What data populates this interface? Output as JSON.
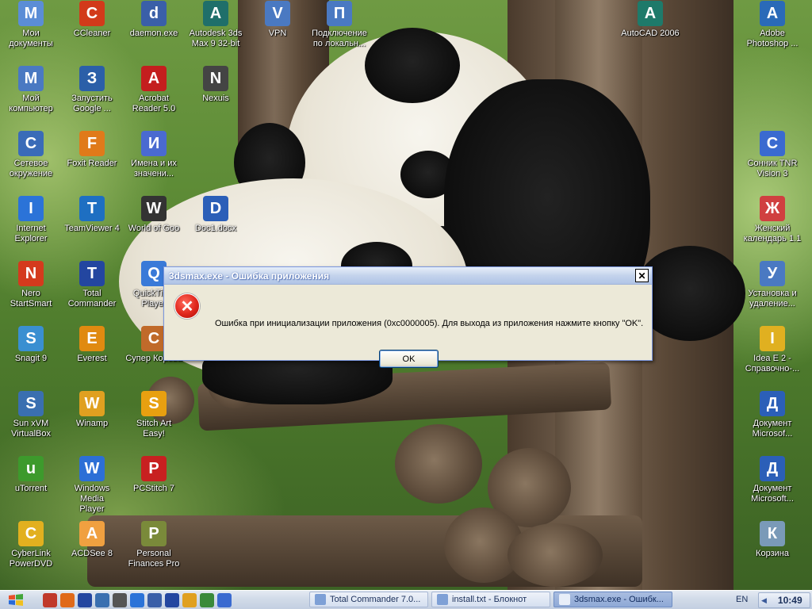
{
  "desktop": {
    "icons": [
      {
        "label": "Мои\nдокументы",
        "icon": "my-documents-icon",
        "color": "#5b8dd6"
      },
      {
        "label": "Мой\nкомпьютер",
        "icon": "my-computer-icon",
        "color": "#4a79c2"
      },
      {
        "label": "Сетевое\nокружение",
        "icon": "network-icon",
        "color": "#3a6bb8"
      },
      {
        "label": "Internet\nExplorer",
        "icon": "internet-explorer-icon",
        "color": "#2b73d8"
      },
      {
        "label": "Nero\nStartSmart",
        "icon": "nero-icon",
        "color": "#d43a1d"
      },
      {
        "label": "Snagit 9",
        "icon": "snagit-icon",
        "color": "#3a8fd1"
      },
      {
        "label": "Sun xVM\nVirtualBox",
        "icon": "virtualbox-icon",
        "color": "#3a6fb0"
      },
      {
        "label": "uTorrent",
        "icon": "utorrent-icon",
        "color": "#3d9a2c"
      },
      {
        "label": "CyberLink\nPowerDVD",
        "icon": "powerdvd-icon",
        "color": "#e2b01f"
      },
      {
        "label": "CCleaner",
        "icon": "ccleaner-icon",
        "color": "#d23a1a"
      },
      {
        "label": "Запустить\nGoogle ...",
        "icon": "google-earth-icon",
        "color": "#2b5fa8"
      },
      {
        "label": "Foxit Reader",
        "icon": "foxit-reader-icon",
        "color": "#e07a1a"
      },
      {
        "label": "TeamViewer 4",
        "icon": "teamviewer-icon",
        "color": "#1e6fc2"
      },
      {
        "label": "Total\nCommander",
        "icon": "total-commander-icon",
        "color": "#2346a0"
      },
      {
        "label": "Everest",
        "icon": "everest-icon",
        "color": "#e08a10"
      },
      {
        "label": "Winamp",
        "icon": "winamp-icon",
        "color": "#e0a020"
      },
      {
        "label": "Windows Media\nPlayer",
        "icon": "windows-media-player-icon",
        "color": "#2c6fd6"
      },
      {
        "label": "ACDSee 8",
        "icon": "acdsee-icon",
        "color": "#f0a040"
      },
      {
        "label": "daemon.exe",
        "icon": "daemon-tools-icon",
        "color": "#3a5fa8"
      },
      {
        "label": "Acrobat\nReader 5.0",
        "icon": "acrobat-reader-icon",
        "color": "#c41e1e"
      },
      {
        "label": "Имена и их\nзначени...",
        "icon": "names-app-icon",
        "color": "#4a6ad0"
      },
      {
        "label": "World of Goo",
        "icon": "world-of-goo-icon",
        "color": "#333333"
      },
      {
        "label": "QuickTime\nPlayer",
        "icon": "quicktime-icon",
        "color": "#3a7ad8"
      },
      {
        "label": "Супер Корова",
        "icon": "super-cow-icon",
        "color": "#c06a2a"
      },
      {
        "label": "Stitch Art\nEasy!",
        "icon": "stitch-art-icon",
        "color": "#e8a010"
      },
      {
        "label": "PCStitch 7",
        "icon": "pcstitch-icon",
        "color": "#c82020"
      },
      {
        "label": "Personal\nFinances Pro",
        "icon": "personal-finances-icon",
        "color": "#7a8a3a"
      },
      {
        "label": "Autodesk 3ds\nMax 9 32-bit",
        "icon": "3ds-max-icon",
        "color": "#1f6f6a"
      },
      {
        "label": "Nexuis",
        "icon": "nexuis-icon",
        "color": "#444444"
      },
      {
        "label": "Doc1.docx",
        "icon": "word-document-icon",
        "color": "#2b5fb8"
      },
      {
        "label": "VPN",
        "icon": "vpn-icon",
        "color": "#4a79c2"
      },
      {
        "label": "Подключение\nпо локальн...",
        "icon": "local-connection-icon",
        "color": "#4a79c2"
      },
      {
        "label": "AutoCAD 2006",
        "icon": "autocad-icon",
        "color": "#1e7a6a"
      },
      {
        "label": "Adobe\nPhotoshop ...",
        "icon": "photoshop-icon",
        "color": "#2a6ab8"
      },
      {
        "label": "Сонник TNR\nVision 3",
        "icon": "dream-book-icon",
        "color": "#3a6ad0"
      },
      {
        "label": "Женский\nкалендарь 1.1",
        "icon": "calendar-icon",
        "color": "#d04040"
      },
      {
        "label": "Установка и\nудаление...",
        "icon": "add-remove-programs-icon",
        "color": "#4a79c2"
      },
      {
        "label": "Idea E 2 -\nСправочно-...",
        "icon": "idea-book-icon",
        "color": "#e0b020"
      },
      {
        "label": "Документ\nMicrosof...",
        "icon": "word-document-icon",
        "color": "#2b5fb8"
      },
      {
        "label": "Документ\nMicrosoft...",
        "icon": "word-document-icon",
        "color": "#2b5fb8"
      },
      {
        "label": "Корзина",
        "icon": "recycle-bin-icon",
        "color": "#7a9ab8"
      }
    ]
  },
  "dialog": {
    "title": "3dsmax.exe - Ошибка приложения",
    "message": "Ошибка при инициализации приложения (0xc0000005). Для выхода из приложения нажмите кнопку \"OK\".",
    "ok_label": "OK",
    "close_symbol": "✕"
  },
  "taskbar": {
    "quick_launch": [
      {
        "icon": "show-desktop-icon",
        "color": "#c0392b"
      },
      {
        "icon": "firefox-icon",
        "color": "#e06a1a"
      },
      {
        "icon": "total-commander-icon",
        "color": "#2346a0"
      },
      {
        "icon": "virtualbox-icon",
        "color": "#3a6fb0"
      },
      {
        "icon": "media-icon",
        "color": "#555555"
      },
      {
        "icon": "internet-explorer-icon",
        "color": "#2b73d8"
      },
      {
        "icon": "monitor-icon",
        "color": "#3a5fa8"
      },
      {
        "icon": "save-icon",
        "color": "#2346a0"
      },
      {
        "icon": "winamp-icon",
        "color": "#e0a020"
      },
      {
        "icon": "network-icon",
        "color": "#3a8a3a"
      },
      {
        "icon": "search-icon",
        "color": "#3a6ad0"
      }
    ],
    "tasks": [
      {
        "label": "Total Commander 7.0...",
        "icon": "total-commander-icon",
        "active": false
      },
      {
        "label": "install.txt - Блокнот",
        "icon": "notepad-icon",
        "active": false
      },
      {
        "label": "3dsmax.exe - Ошибк...",
        "icon": "error-window-icon",
        "active": true
      }
    ],
    "language": "EN",
    "clock": "10:49"
  },
  "colors": {
    "accent_blue": "#3a6ad0",
    "error_red": "#e0261c",
    "dialog_bg": "#ece9d8"
  }
}
